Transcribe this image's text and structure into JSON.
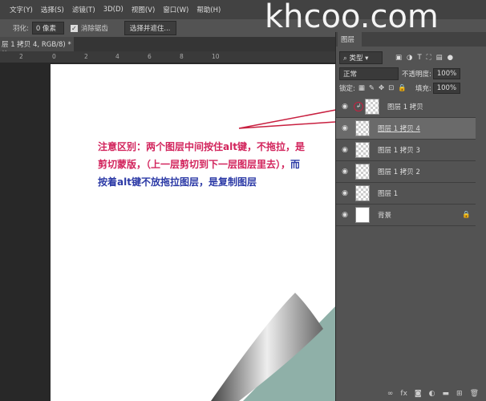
{
  "menu": [
    "文字(Y)",
    "选择(S)",
    "滤镜(T)",
    "3D(D)",
    "视图(V)",
    "窗口(W)",
    "帮助(H)"
  ],
  "options": {
    "feather_label": "羽化:",
    "feather_value": "0 像素",
    "antialias_label": "消除锯齿",
    "select_mask_button": "选择并遮住..."
  },
  "doc_tab": {
    "title": "层 1 拷贝 4, RGB/8) *",
    "close": "×"
  },
  "ruler": [
    "2",
    "0",
    "2",
    "4",
    "6",
    "8",
    "10"
  ],
  "note": {
    "red1": "注意区别：两个图层中间按住alt键，不拖拉，是剪切蒙版，（上一层剪切到下一层图层里去），",
    "blue1": "而按着alt键不放拖拉图层，是复制图层"
  },
  "panel": {
    "tab": "图层",
    "filter": "类型",
    "blend": "正常",
    "opacity_label": "不透明度:",
    "opacity": "100%",
    "lock_label": "锁定:",
    "fill_label": "填充:",
    "fill": "100%",
    "layers": [
      {
        "name": "图层 1 拷贝"
      },
      {
        "name": "图层 1 拷贝 4"
      },
      {
        "name": "图层 1 拷贝 3"
      },
      {
        "name": "图层 1 拷贝 2"
      },
      {
        "name": "图层 1"
      },
      {
        "name": "背景"
      }
    ]
  },
  "watermark": "khcoo.com"
}
